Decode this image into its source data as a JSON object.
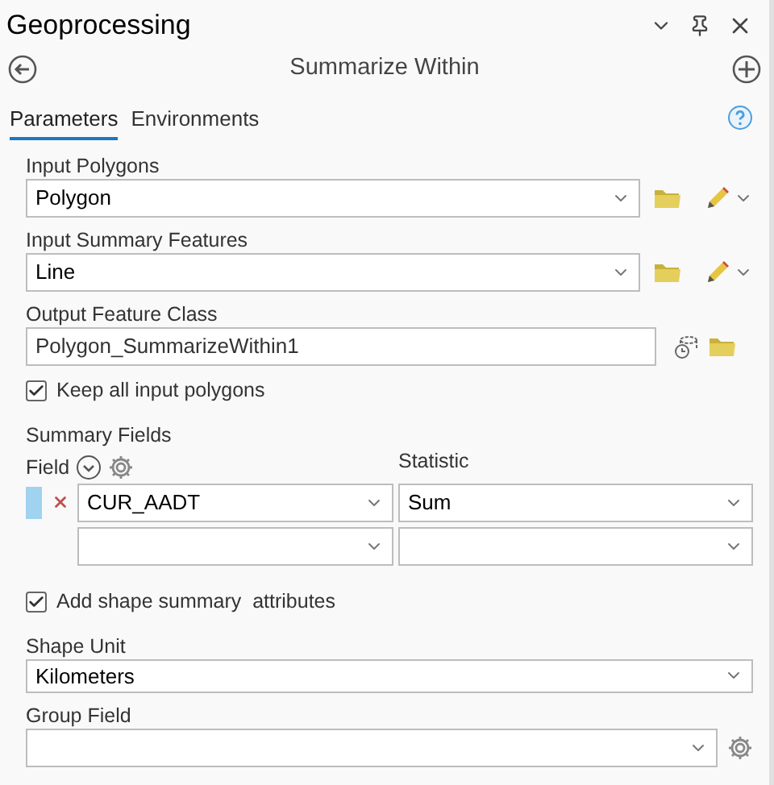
{
  "window": {
    "title": "Geoprocessing"
  },
  "tool": {
    "title": "Summarize Within"
  },
  "tabs": [
    {
      "label": "Parameters",
      "selected": true
    },
    {
      "label": "Environments",
      "selected": false
    }
  ],
  "parameters": [
    {
      "kind": "layer",
      "label": "Input Polygons",
      "value": "Polygon"
    },
    {
      "kind": "layer",
      "label": "Input Summary Features",
      "value": "Line"
    },
    {
      "kind": "output",
      "label": "Output Feature Class",
      "value": "Polygon_SummarizeWithin1"
    },
    {
      "kind": "checkbox",
      "label": "Keep all input polygons",
      "checked": true
    },
    {
      "kind": "summary",
      "label": "Summary Fields",
      "field_header": "Field",
      "statistic_header": "Statistic",
      "rows": [
        {
          "kind": "entry",
          "selected": true,
          "field": "CUR_AADT",
          "statistic": "Sum"
        },
        {
          "kind": "blank",
          "selected": false
        }
      ]
    },
    {
      "kind": "checkbox",
      "label": "Add shape summary  attributes",
      "checked": true
    },
    {
      "kind": "dropdown",
      "label": "Shape Unit",
      "value": "Kilometers"
    },
    {
      "kind": "group",
      "label": "Group Field"
    }
  ]
}
